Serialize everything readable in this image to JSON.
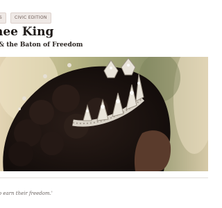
{
  "tags": [
    {
      "label": "ES"
    },
    {
      "label": "CIVIC EDITION"
    }
  ],
  "article": {
    "title": "Pageant Queen Makes History as Queen King",
    "title_visible": "nee King",
    "subtitle_visible": "& the Baton of Freedom"
  },
  "hero": {
    "icon": "hero-photo-crown"
  },
  "caption": {
    "text": "'o earn their freedom.'"
  }
}
